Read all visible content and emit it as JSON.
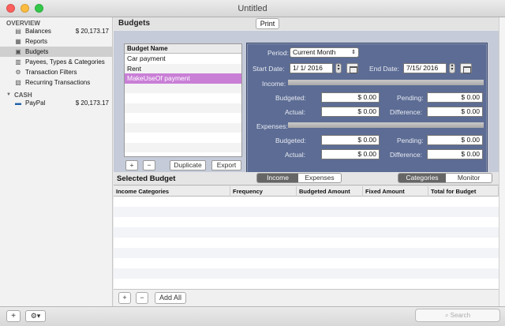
{
  "window": {
    "title": "Untitled"
  },
  "sidebar": {
    "overview_header": "OVERVIEW",
    "items": [
      {
        "label": "Balances",
        "amount": "$ 20,173.17",
        "icon": "balances-icon"
      },
      {
        "label": "Reports",
        "amount": "",
        "icon": "reports-icon"
      },
      {
        "label": "Budgets",
        "amount": "",
        "icon": "budgets-icon",
        "selected": true
      },
      {
        "label": "Payees, Types & Categories",
        "amount": "",
        "icon": "payees-icon"
      },
      {
        "label": "Transaction Filters",
        "amount": "",
        "icon": "filter-icon"
      },
      {
        "label": "Recurring Transactions",
        "amount": "",
        "icon": "recurring-icon"
      }
    ],
    "cash_header": "CASH",
    "accounts": [
      {
        "label": "PayPal",
        "amount": "$ 20,173.17",
        "icon": "paypal-icon"
      }
    ]
  },
  "header": {
    "title": "Budgets",
    "print_label": "Print"
  },
  "budget_list": {
    "column": "Budget Name",
    "rows": [
      "Car payment",
      "Rent",
      "MakeUseOf payment"
    ],
    "selected_index": 2,
    "duplicate_label": "Duplicate",
    "export_label": "Export",
    "add_label": "+",
    "remove_label": "−"
  },
  "inspector": {
    "period_label": "Period:",
    "period_value": "Current Month",
    "start_label": "Start Date:",
    "start_value": "1/  1/ 2016",
    "end_label": "End Date:",
    "end_value": "7/15/ 2016",
    "income_label": "Income:",
    "expenses_label": "Expenses:",
    "budgeted_label": "Budgeted:",
    "pending_label": "Pending:",
    "actual_label": "Actual:",
    "difference_label": "Difference:",
    "income_budgeted": "$ 0.00",
    "income_pending": "$ 0.00",
    "income_actual": "$ 0.00",
    "income_difference": "$ 0.00",
    "expenses_budgeted": "$ 0.00",
    "expenses_pending": "$ 0.00",
    "expenses_actual": "$ 0.00",
    "expenses_difference": "$ 0.00"
  },
  "selected_budget": {
    "title": "Selected Budget",
    "seg1": {
      "income": "Income",
      "expenses": "Expenses",
      "active": "income"
    },
    "seg2": {
      "categories": "Categories",
      "monitor": "Monitor",
      "active": "categories"
    },
    "columns": [
      "Income Categories",
      "Frequency",
      "Budgeted Amount",
      "Fixed Amount",
      "Total for Budget"
    ],
    "add_all_label": "Add All",
    "add_label": "+",
    "remove_label": "−"
  },
  "bottombar": {
    "add_label": "+",
    "search_placeholder": "Search"
  },
  "colors": {
    "selection": "#c97fd6",
    "inspector": "#5c6c94",
    "panel": "#c5cbd8"
  }
}
